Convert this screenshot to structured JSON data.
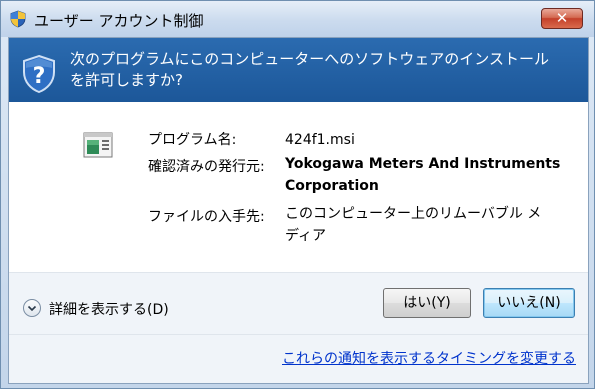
{
  "window": {
    "title": "ユーザー アカウント制御",
    "close_label": "✕"
  },
  "banner": {
    "question_line1": "次のプログラムにこのコンピューターへのソフトウェアのインストール",
    "question_line2": "を許可しますか?"
  },
  "details": {
    "program_name_label": "プログラム名:",
    "program_name_value": "424f1.msi",
    "publisher_label": "確認済みの発行元:",
    "publisher_value_line1": "Yokogawa Meters And Instruments",
    "publisher_value_line2": "Corporation",
    "origin_label": "ファイルの入手先:",
    "origin_value_line1": "このコンピューター上のリムーバブル メ",
    "origin_value_line2": "ディア"
  },
  "footer": {
    "show_details": "詳細を表示する(D)",
    "yes_button": "はい(Y)",
    "no_button": "いいえ(N)",
    "notification_link": "これらの通知を表示するタイミングを変更する"
  },
  "colors": {
    "banner": "#1c5799",
    "link": "#0033cc",
    "close": "#c4402a"
  }
}
